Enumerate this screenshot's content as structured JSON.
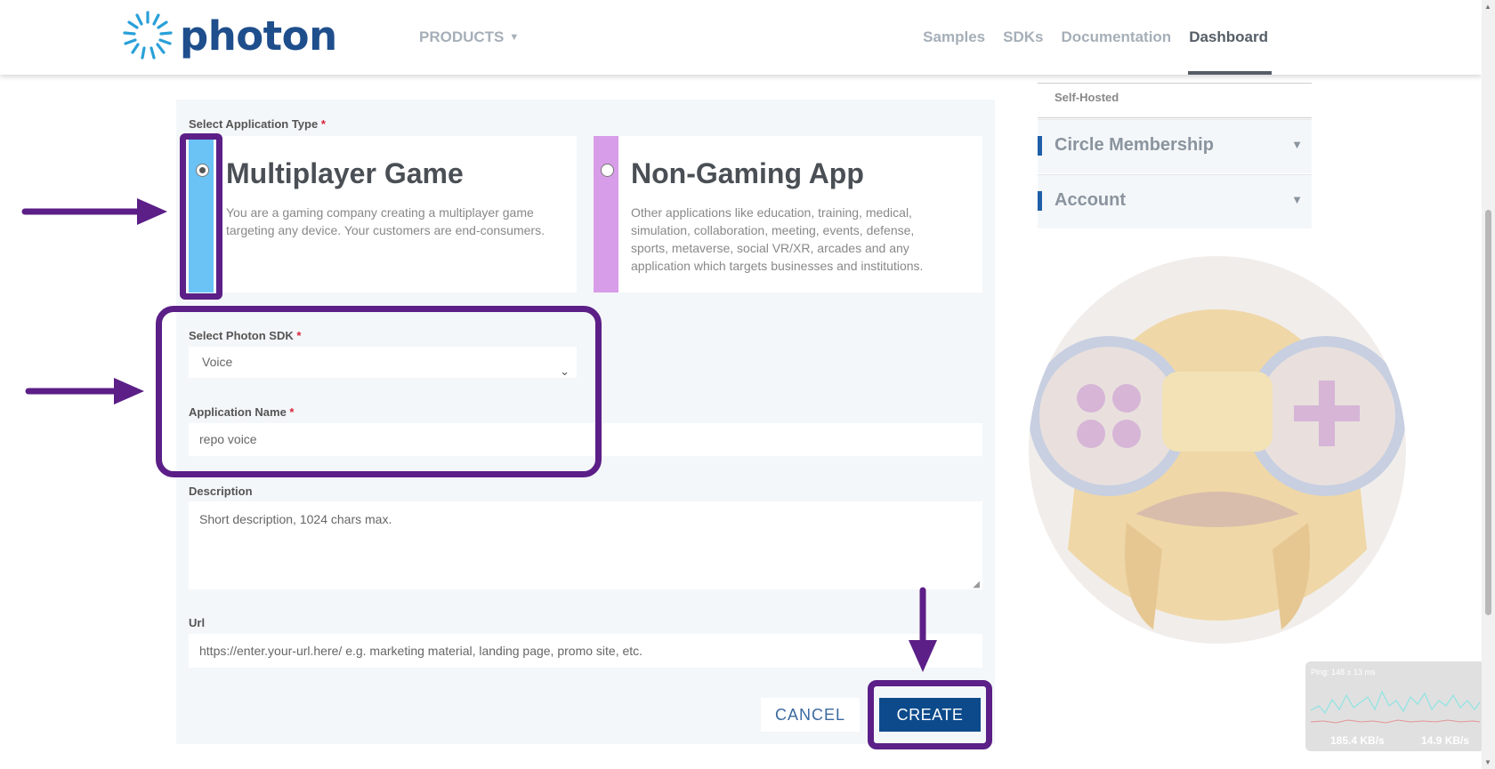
{
  "header": {
    "logo_text": "photon",
    "products_label": "PRODUCTS",
    "nav": [
      "Samples",
      "SDKs",
      "Documentation",
      "Dashboard"
    ],
    "active_nav": "Dashboard"
  },
  "form": {
    "app_type_label": "Select Application Type",
    "required_mark": "*",
    "cards": [
      {
        "title": "Multiplayer Game",
        "description": "You are a gaming company creating a multiplayer game targeting any device. Your customers are end-consumers.",
        "selected": true,
        "color": "#6bc2f5"
      },
      {
        "title": "Non-Gaming App",
        "description": "Other applications like education, training, medical, simulation, collaboration, meeting, events, defense, sports, metaverse, social VR/XR, arcades and any application which targets businesses and institutions.",
        "selected": false,
        "color": "#d89de8"
      }
    ],
    "sdk_label": "Select Photon SDK",
    "sdk_value": "Voice",
    "name_label": "Application Name",
    "name_value": "repo voice",
    "description_label": "Description",
    "description_placeholder": "Short description, 1024 chars max.",
    "url_label": "Url",
    "url_placeholder": "https://enter.your-url.here/ e.g. marketing material, landing page, promo site, etc.",
    "cancel_label": "CANCEL",
    "create_label": "CREATE"
  },
  "sidebar": {
    "self_hosted": "Self-Hosted",
    "items": [
      {
        "label": "Circle Membership"
      },
      {
        "label": "Account"
      }
    ]
  },
  "netgraph": {
    "ping": "Ping: 148 ± 13 ms",
    "down_rate": "185.4 KB/s",
    "up_rate": "14.9 KB/s"
  },
  "colors": {
    "brand": "#1e4e8c",
    "create_button": "#0d4a8b",
    "annotation": "#5b1f87",
    "required": "#d9243e"
  }
}
